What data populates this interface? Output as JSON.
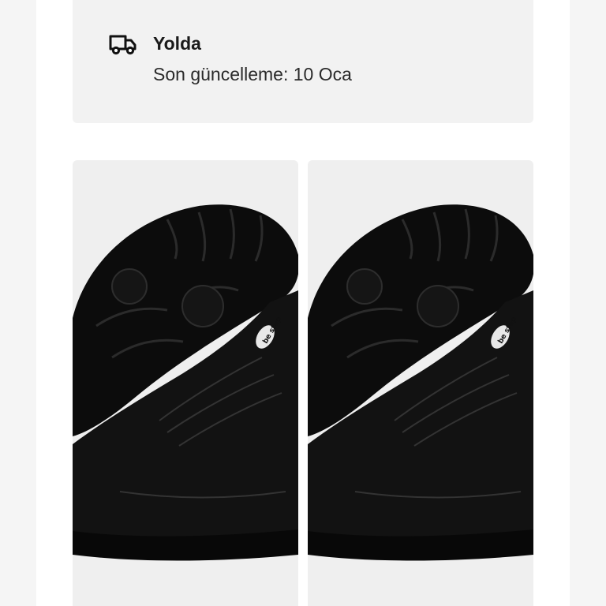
{
  "shipment": {
    "icon": "truck-icon",
    "status_label": "Yolda",
    "last_update": "Son güncelleme: 10 Oca"
  },
  "products": [
    {
      "image": "black barefoot boot with laces",
      "logo_text": "be step"
    },
    {
      "image": "black barefoot boot with laces",
      "logo_text": "be step"
    }
  ]
}
